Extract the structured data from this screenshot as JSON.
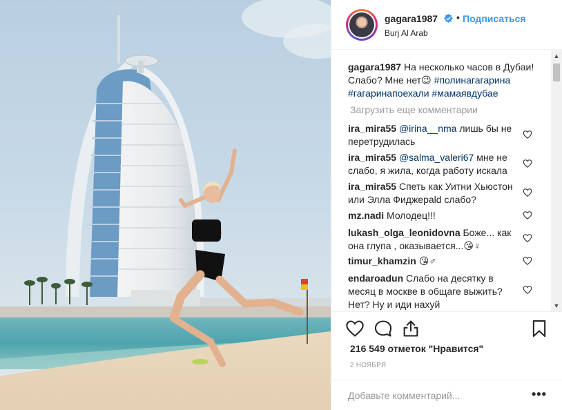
{
  "post": {
    "username": "gagara1987",
    "follow_label": "Подписаться",
    "separator": "•",
    "location": "Burj Al Arab",
    "caption": {
      "username": "gagara1987",
      "text": " На несколько часов в Дубаи! Слабо? Мне нет😉 ",
      "tags": "#полинагагарина #гагаринапоехали #мамаявдубае"
    },
    "load_more_label": "Загрузить еще комментарии",
    "comments": [
      {
        "username": "ira_mira55",
        "mention": "@irina__nma",
        "text": " лишь бы не перетрудилась"
      },
      {
        "username": "ira_mira55",
        "mention": "@salma_valeri67",
        "text": " мне не слабо, я жила, когда работу искала"
      },
      {
        "username": "ira_mira55",
        "mention": "",
        "text": " Спеть как Уитни Хьюстон или Элла Фиджерald слабо?"
      },
      {
        "username": "mz.nadi",
        "mention": "",
        "text": " Молодец!!!"
      },
      {
        "username": "lukash_olga_leonidovna",
        "mention": "",
        "text": " Боже... как она глупа , оказывается...😘♀"
      },
      {
        "username": "timur_khamzin",
        "mention": "",
        "text": " 😘♂"
      },
      {
        "username": "endaroadun",
        "mention": "",
        "text": " Слабо на десятку в месяц в москве в общаге выжить? Нет? Ну и иди нахуй"
      }
    ],
    "likes": "216 549 отметок \"Нравится\"",
    "date": "2 НОЯБРЯ",
    "add_comment_placeholder": "Добавьте комментарий...",
    "more_label": "•••"
  },
  "colors": {
    "link": "#3897f0",
    "hashtag": "#003569",
    "muted": "#999999",
    "text": "#262626"
  },
  "icons": {
    "verified": "verified-badge-icon",
    "like": "heart-outline-icon",
    "comment": "comment-bubble-icon",
    "share": "share-upload-icon",
    "save": "bookmark-icon",
    "comment_like": "small-heart-icon"
  }
}
